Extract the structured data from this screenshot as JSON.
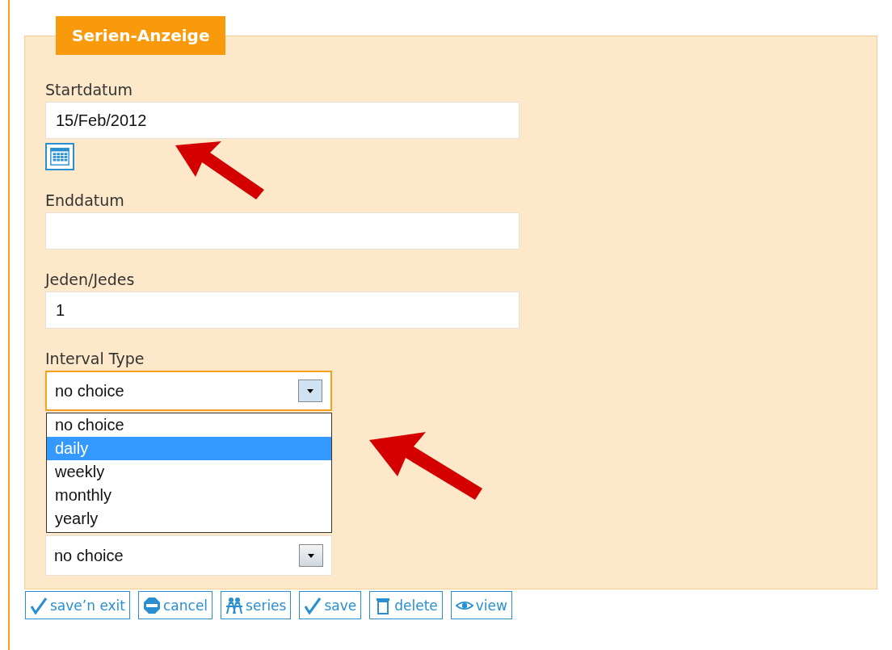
{
  "panel": {
    "title": "Serien-Anzeige"
  },
  "fields": [
    {
      "kind": "date",
      "label": "Startdatum",
      "value": "15/Feb/2012"
    },
    {
      "kind": "text",
      "label": "Enddatum"
    },
    {
      "kind": "text",
      "label": "Jeden/Jedes",
      "value": "1"
    },
    {
      "kind": "select",
      "label": "Interval Type",
      "value": "no choice",
      "focused": true,
      "expanded": true,
      "options": [
        {
          "label": "no choice",
          "highlighted": false
        },
        {
          "label": "daily",
          "highlighted": true
        },
        {
          "label": "weekly",
          "highlighted": false
        },
        {
          "label": "monthly",
          "highlighted": false
        },
        {
          "label": "yearly",
          "highlighted": false
        }
      ]
    },
    {
      "kind": "select",
      "value": "no choice",
      "focused": false
    }
  ],
  "buttons": [
    {
      "kind": "check",
      "label": "save’n exit"
    },
    {
      "kind": "stop",
      "label": "cancel"
    },
    {
      "kind": "people",
      "label": "series"
    },
    {
      "kind": "check",
      "label": "save"
    },
    {
      "kind": "trash",
      "label": "delete"
    },
    {
      "kind": "eye",
      "label": "view"
    }
  ]
}
